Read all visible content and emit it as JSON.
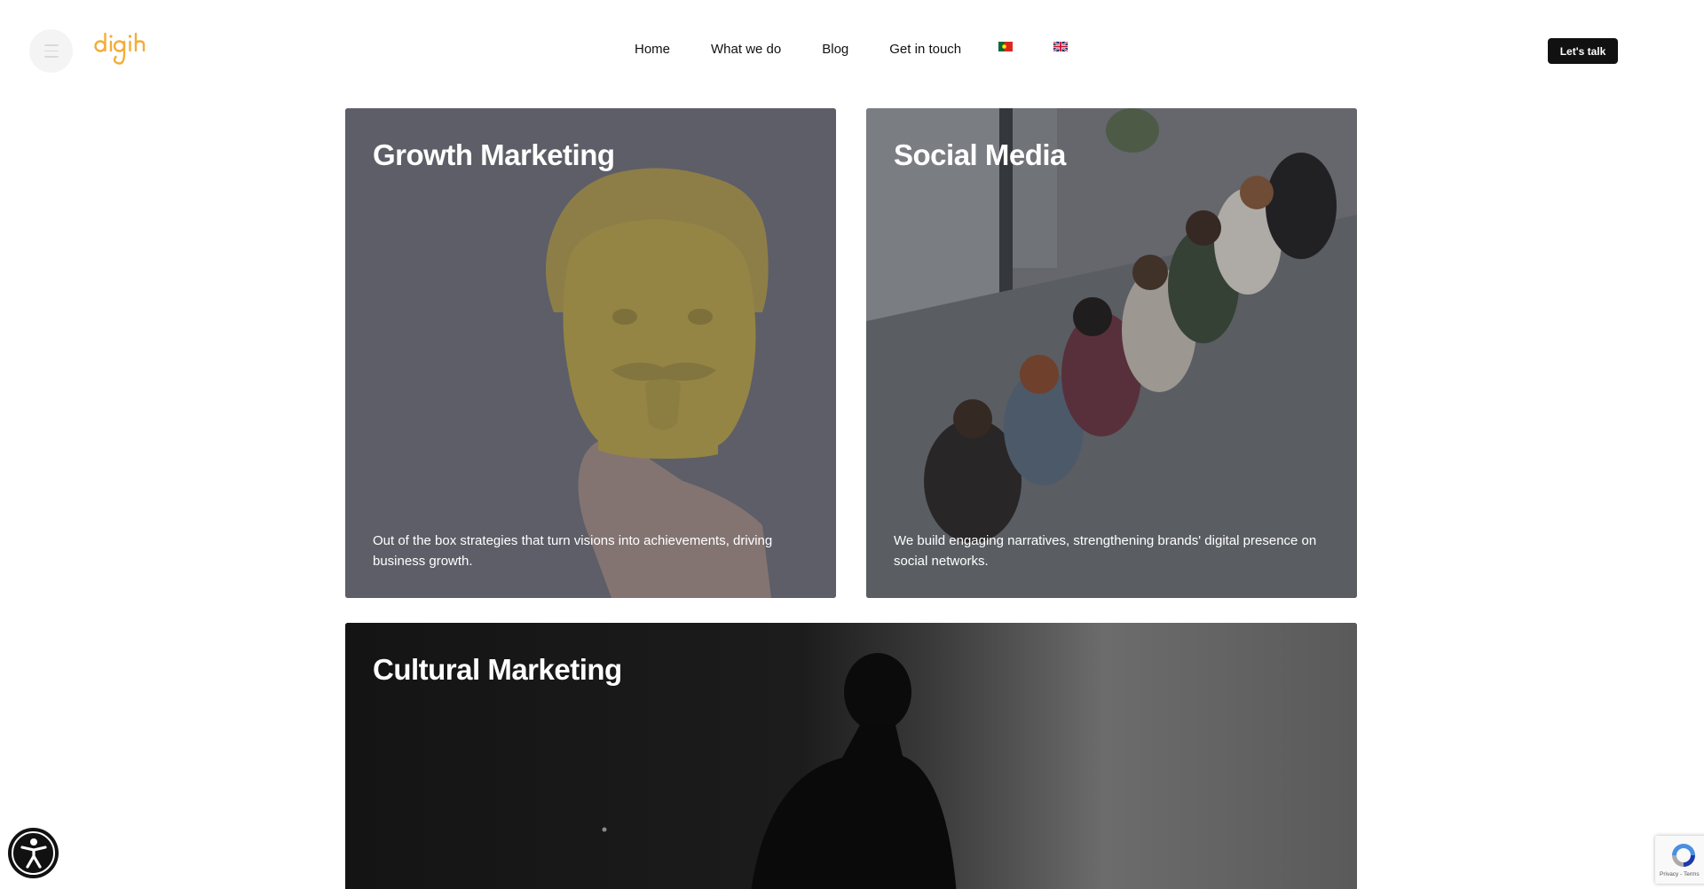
{
  "header": {
    "nav": [
      {
        "label": "Home"
      },
      {
        "label": "What we do"
      },
      {
        "label": "Blog"
      },
      {
        "label": "Get in touch"
      }
    ],
    "languages": [
      {
        "icon": "portugal-flag-icon"
      },
      {
        "icon": "uk-flag-icon"
      }
    ],
    "cta_label": "Let's talk",
    "brand_color": "#f2ad3a"
  },
  "cards": [
    {
      "title": "Growth Marketing",
      "description": "Out of the box strategies that turn visions into achievements, driving business growth."
    },
    {
      "title": "Social Media",
      "description": "We build engaging narratives, strengthening brands' digital presence on social networks."
    },
    {
      "title": "Cultural Marketing"
    }
  ],
  "recaptcha": {
    "terms": "Privacy - Terms"
  }
}
